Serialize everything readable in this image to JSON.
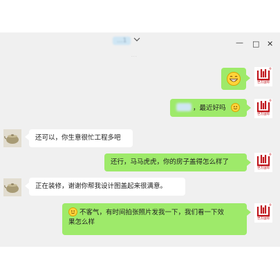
{
  "window": {
    "title": "...1",
    "subtitle": "...",
    "controls": {
      "minimize": "—",
      "maximize": "□",
      "close": "✕"
    }
  },
  "brand": {
    "name": "世方国际",
    "registered": "®",
    "color": "#c0161c"
  },
  "messages": [
    {
      "direction": "out",
      "type": "emoji",
      "emoji_name": "grinning-face-icon"
    },
    {
      "direction": "out",
      "type": "text",
      "text": "，最近好吗",
      "emoji_after": "smiling-face-icon"
    },
    {
      "direction": "in",
      "type": "text",
      "text": "还可以，你生意很忙工程多吧"
    },
    {
      "direction": "out",
      "type": "text",
      "text": "还行，马马虎虎，你的房子盖得怎么样了"
    },
    {
      "direction": "in",
      "type": "text",
      "text": "正在装修，谢谢你帮我设计图盖起来很满意。"
    },
    {
      "direction": "out",
      "type": "text",
      "line1": "不客气，有时间拍张照片发我一下，我们看一下效",
      "line2": "果怎么样",
      "emoji_before": "smiling-face-icon"
    }
  ],
  "colors": {
    "outgoing_bubble": "#9eea6a",
    "incoming_bubble": "#ffffff",
    "background": "#f0f0f0"
  }
}
